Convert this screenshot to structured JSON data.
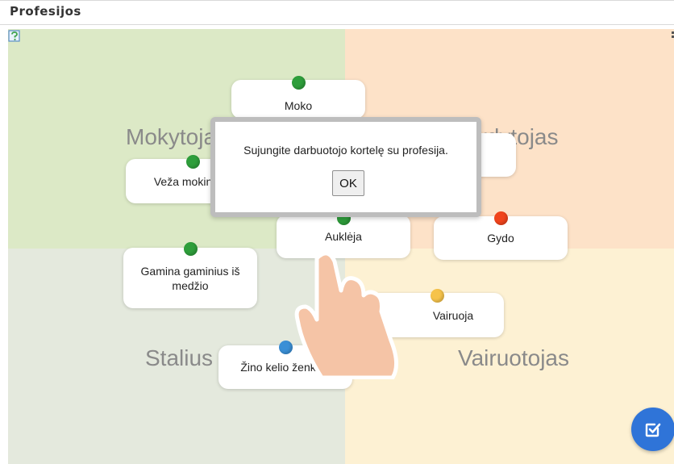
{
  "header": {
    "title": "Profesijos"
  },
  "quadrants": [
    {
      "key": "tl",
      "label": "Mokytojas"
    },
    {
      "key": "tr",
      "label": "Gydytojas"
    },
    {
      "key": "bl",
      "label": "Stalius"
    },
    {
      "key": "br",
      "label": "Vairuotojas"
    }
  ],
  "cards": [
    {
      "text": "Moko",
      "dot_color": "#2e9e3b"
    },
    {
      "text": "Veža mokinius",
      "dot_color": "#2e9e3b"
    },
    {
      "text": "",
      "dot_color": "#2e9e3b"
    },
    {
      "text": "Auklėja",
      "dot_color": "#2e9e3b"
    },
    {
      "text": "Gydo",
      "dot_color": "#f0441c"
    },
    {
      "text": "Gamina gaminius iš medžio",
      "dot_color": "#2e9e3b"
    },
    {
      "text": "Vairuoja",
      "dot_color": "#f6c34a"
    },
    {
      "text": "Žino kelio ženklus",
      "dot_color": "#3a8fd6"
    }
  ],
  "dialog": {
    "message": "Sujungite darbuotojo kortelę su profesija.",
    "ok_label": "OK"
  },
  "colors": {
    "accent": "#2f74d8",
    "quadrant_tl": "#dce9c6",
    "quadrant_tr": "#fde2c8",
    "quadrant_bl": "#e4e9dd",
    "quadrant_br": "#fdf1d3"
  },
  "icons": {
    "help": "help-edit-icon",
    "hand": "pointing-hand-icon",
    "check": "check-square-icon"
  }
}
